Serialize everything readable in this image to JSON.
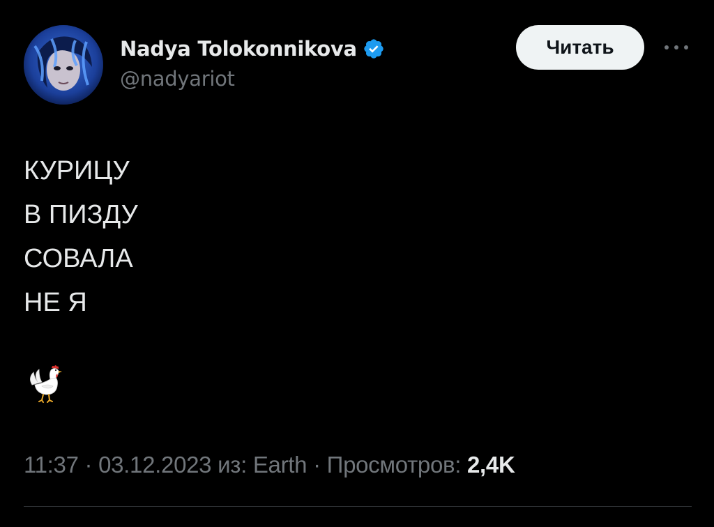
{
  "author": {
    "display_name": "Nadya Tolokonnikova",
    "handle": "@nadyariot",
    "verified": true,
    "avatar": "profile-photo"
  },
  "actions": {
    "follow_label": "Читать",
    "more_icon": "more-horizontal-icon"
  },
  "tweet": {
    "lines": [
      "КУРИЦУ",
      "В ПИЗДУ",
      "СОВАЛА",
      "НЕ Я"
    ],
    "emoji": "🐓"
  },
  "meta": {
    "time": "11:37",
    "date": "03.12.2023",
    "source_prefix": "из:",
    "source": "Earth",
    "separator": " · ",
    "views_label": "Просмотров:",
    "views_count": "2,4K"
  },
  "colors": {
    "background": "#000000",
    "text_primary": "#e7e9ea",
    "text_secondary": "#71767b",
    "verified_blue": "#1d9bf0",
    "button_bg": "#eff3f4",
    "divider": "#2f3336"
  }
}
